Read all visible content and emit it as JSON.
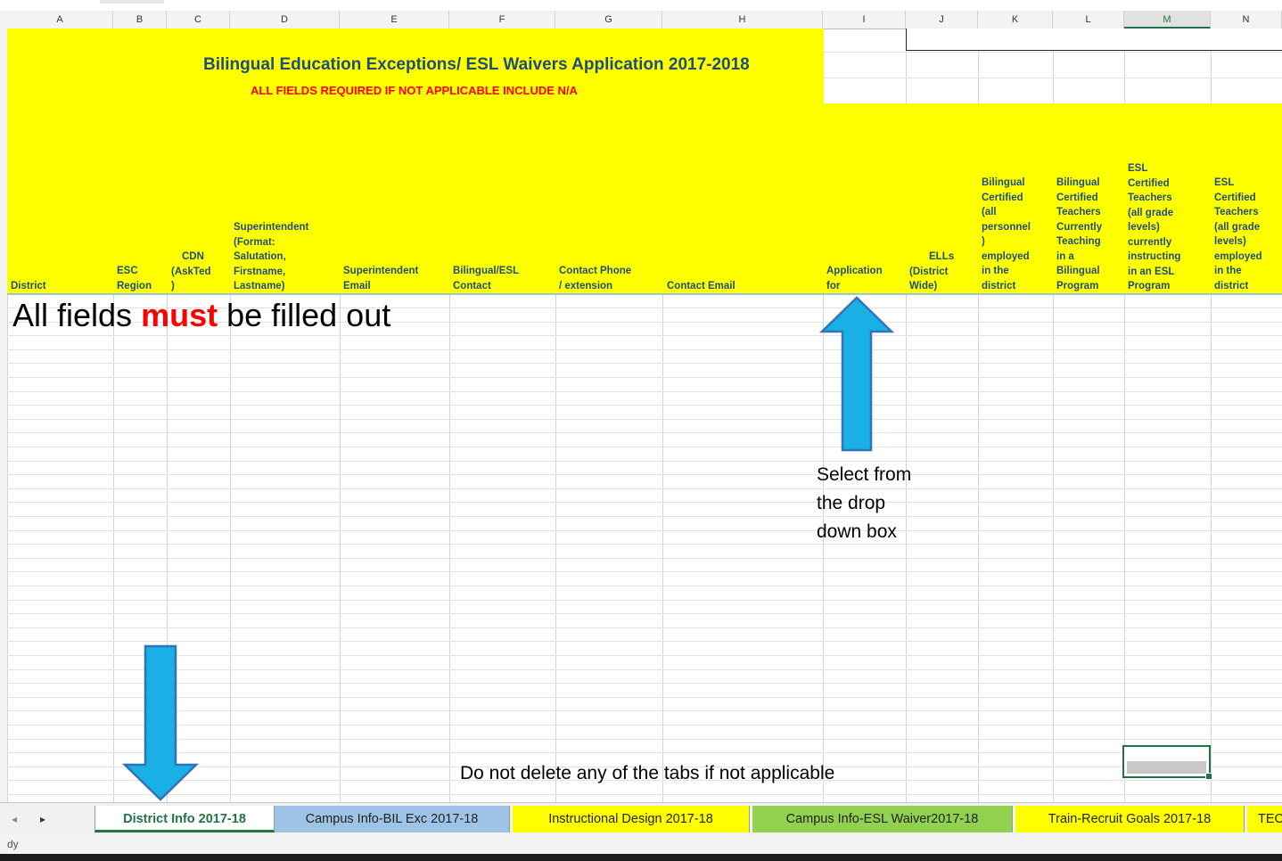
{
  "columns": [
    "A",
    "B",
    "C",
    "D",
    "E",
    "F",
    "G",
    "H",
    "I",
    "J",
    "K",
    "L",
    "M",
    "N"
  ],
  "active_column": "M",
  "title": "Bilingual Education Exceptions/ ESL Waivers Application 2017-2018",
  "subtitle": "ALL FIELDS REQUIRED IF NOT APPLICABLE INCLUDE N/A",
  "headers": {
    "district": "District",
    "esc_region": [
      "ESC",
      "Region"
    ],
    "cdn": [
      "CDN",
      "(AskTed",
      ")"
    ],
    "superintendent": [
      "Superintendent",
      "(Format:",
      "Salutation,",
      "Firstname,",
      "Lastname)"
    ],
    "superintendent_email": [
      "Superintendent",
      "Email"
    ],
    "bilingual_esl_contact": [
      "Bilingual/ESL",
      "Contact"
    ],
    "contact_phone": [
      "Contact Phone",
      "/ extension"
    ],
    "contact_email": "Contact Email",
    "application_for": [
      "Application",
      "for"
    ],
    "ells": [
      "ELLs",
      "(District",
      "Wide)"
    ],
    "bilingual_certified_all": [
      "Bilingual",
      "Certified",
      "(all",
      "personnel",
      ")",
      "employed",
      "in the",
      "district"
    ],
    "bilingual_certified_teaching": [
      "Bilingual",
      "Certified",
      "Teachers",
      "Currently",
      "Teaching",
      "in a",
      "Bilingual",
      "Program"
    ],
    "esl_certified_instructing": [
      "ESL",
      "Certified",
      "Teachers",
      "(all grade",
      "levels)",
      "currently",
      "instructing",
      "in an ESL",
      "Program"
    ],
    "esl_certified_employed": [
      "ESL",
      "Certified",
      "Teachers",
      "(all grade",
      "levels)",
      "employed",
      "in the",
      "district"
    ]
  },
  "notes": {
    "all_fields_prefix": "All fields ",
    "all_fields_emphasis": "must",
    "all_fields_suffix": " be filled out",
    "dropdown_hint": [
      "Select from",
      "the drop",
      "down box"
    ],
    "tabs_hint": "Do not delete any of the tabs if not applicable"
  },
  "tabs": [
    {
      "label": "District Info 2017-18",
      "color": "#ffffff",
      "active": true
    },
    {
      "label": "Campus Info-BIL Exc 2017-18",
      "color": "#9dc3e6",
      "active": false
    },
    {
      "label": "Instructional Design 2017-18",
      "color": "#ffff00",
      "active": false
    },
    {
      "label": "Campus Info-ESL Waiver2017-18",
      "color": "#92d050",
      "active": false
    },
    {
      "label": "Train-Recruit Goals 2017-18",
      "color": "#ffff00",
      "active": false
    },
    {
      "label": "TEC",
      "color": "#ffff00",
      "active": false
    }
  ],
  "status": "dy",
  "colors": {
    "header_fill": "#ffff00",
    "title_blue": "#1f4e79",
    "warning_red": "#ff0000",
    "arrow_blue": "#1ab0e6",
    "excel_green": "#217346"
  }
}
